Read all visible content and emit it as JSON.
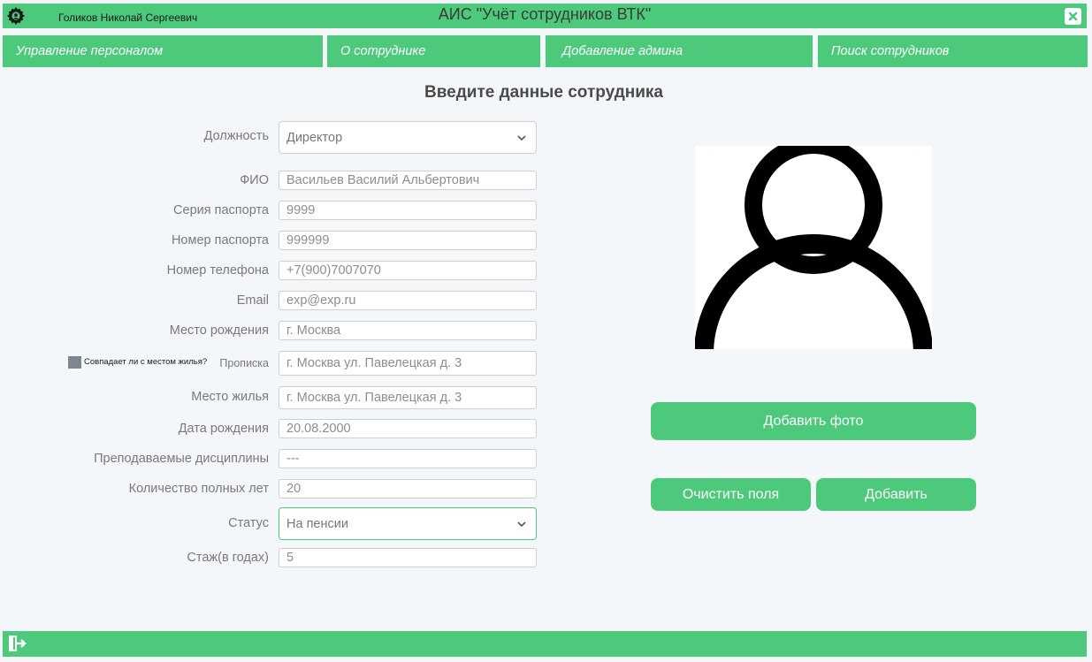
{
  "window": {
    "user_name": "Голиков Николай Сергеевич",
    "title": "АИС \"Учёт сотрудников ВТК\"",
    "accent_color": "#4cc97a"
  },
  "tabs": [
    {
      "label": "Управление персоналом"
    },
    {
      "label": "О сотруднике"
    },
    {
      "label": "Добавление админа"
    },
    {
      "label": "Поиск сотрудников"
    }
  ],
  "form": {
    "heading": "Введите данные сотрудника",
    "position": {
      "label": "Должность",
      "value": "Директор"
    },
    "full_name": {
      "label": "ФИО",
      "value": "Васильев Василий Альбертович"
    },
    "passport_series": {
      "label": "Серия паспорта",
      "value": "9999"
    },
    "passport_number": {
      "label": "Номер паспорта",
      "value": "999999"
    },
    "phone": {
      "label": "Номер телефона",
      "value": "+7(900)7007070"
    },
    "email": {
      "label": "Email",
      "value": "exp@exp.ru"
    },
    "birth_place": {
      "label": "Место рождения",
      "value": "г. Москва"
    },
    "same_as_residence": {
      "label": "Совпадает ли с местом жилья?",
      "checked": false
    },
    "registration": {
      "label": "Прописка",
      "value": "г. Москва ул. Павелецкая д. 3"
    },
    "residence": {
      "label": "Место жилья",
      "value": "г. Москва ул. Павелецкая д. 3"
    },
    "birth_date": {
      "label": "Дата рождения",
      "value": "20.08.2000"
    },
    "disciplines": {
      "label": "Преподаваемые дисциплины",
      "value": "---"
    },
    "age": {
      "label": "Количество полных лет",
      "value": "20"
    },
    "status": {
      "label": "Статус",
      "value": "На пенсии"
    },
    "experience": {
      "label": "Стаж(в годах)",
      "value": "5"
    }
  },
  "photo": {
    "icon": "user-avatar-icon"
  },
  "buttons": {
    "add_photo": "Добавить фото",
    "clear": "Очистить поля",
    "add": "Добавить"
  },
  "footer": {
    "icon": "exit-icon"
  }
}
